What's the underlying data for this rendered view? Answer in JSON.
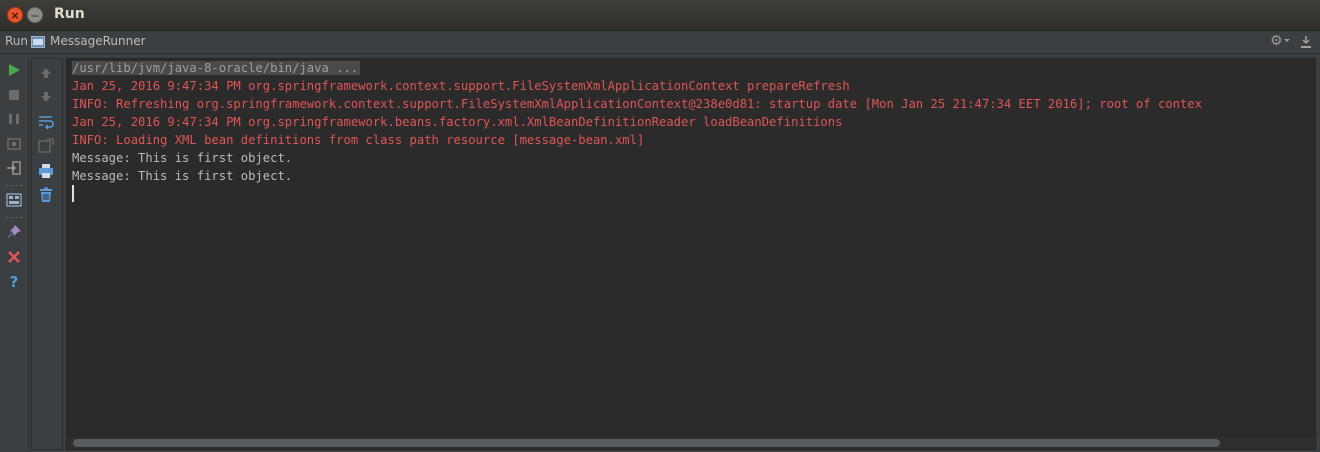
{
  "window": {
    "title": "Run",
    "close_glyph": "×",
    "minimize_glyph": "—"
  },
  "run_header": {
    "label": "Run",
    "configuration": "MessageRunner"
  },
  "icons": {
    "left_toolbar": [
      "rerun-icon",
      "stop-icon",
      "pause-icon",
      "dump-threads-icon",
      "exit-icon",
      "layout-icon",
      "pin-icon",
      "close-icon",
      "help-icon"
    ],
    "second_toolbar": [
      "scroll-up-icon",
      "scroll-down-icon",
      "soft-wrap-icon",
      "scroll-to-end-icon",
      "print-icon",
      "clear-all-icon"
    ],
    "header_right": [
      "gear-icon",
      "hide-icon"
    ]
  },
  "colors": {
    "error": "#e05555",
    "output": "#bbbbbb",
    "rerun": "#4aa84a",
    "close": "#e05555",
    "help": "#4a9fe0"
  },
  "console": {
    "lines": [
      {
        "type": "cmd",
        "text": "/usr/lib/jvm/java-8-oracle/bin/java ..."
      },
      {
        "type": "err",
        "text": "Jan 25, 2016 9:47:34 PM org.springframework.context.support.FileSystemXmlApplicationContext prepareRefresh"
      },
      {
        "type": "err",
        "text": "INFO: Refreshing org.springframework.context.support.FileSystemXmlApplicationContext@238e0d81: startup date [Mon Jan 25 21:47:34 EET 2016]; root of contex"
      },
      {
        "type": "err",
        "text": "Jan 25, 2016 9:47:34 PM org.springframework.beans.factory.xml.XmlBeanDefinitionReader loadBeanDefinitions"
      },
      {
        "type": "err",
        "text": "INFO: Loading XML bean definitions from class path resource [message-bean.xml]"
      },
      {
        "type": "out",
        "text": "Message: This is first object."
      },
      {
        "type": "out",
        "text": "Message: This is first object."
      }
    ]
  }
}
